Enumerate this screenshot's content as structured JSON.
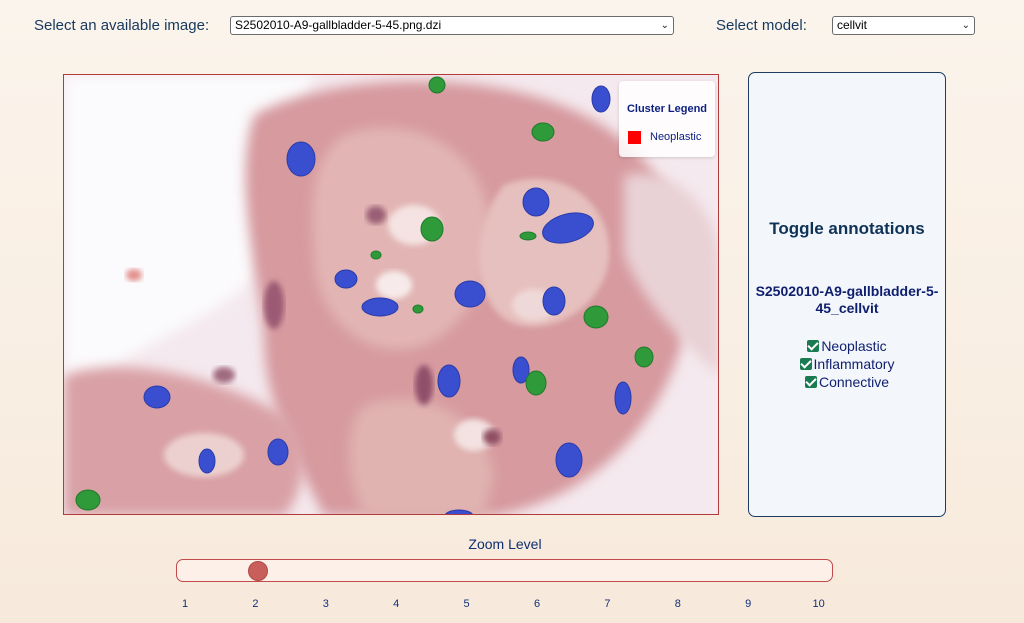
{
  "image_select": {
    "label": "Select an available image:",
    "value": "S2502010-A9-gallbladder-5-45.png.dzi"
  },
  "model_select": {
    "label": "Select model:",
    "value": "cellvit"
  },
  "legend": {
    "title": "Cluster Legend",
    "items": [
      {
        "label": "Neoplastic",
        "color": "#ff0000"
      }
    ]
  },
  "annotations_panel": {
    "title": "Toggle annotations",
    "file": "S2502010-A9-gallbladder-5-45_cellvit",
    "toggles": [
      {
        "label": "Neoplastic",
        "checked": true
      },
      {
        "label": "Inflammatory",
        "checked": true
      },
      {
        "label": "Connective",
        "checked": true
      }
    ]
  },
  "zoom": {
    "title": "Zoom Level",
    "value": 2,
    "min": 1,
    "max": 10,
    "ticks": [
      "1",
      "2",
      "3",
      "4",
      "5",
      "6",
      "7",
      "8",
      "9",
      "10"
    ]
  },
  "colors": {
    "neoplastic_nuclei": "#3a4fd0",
    "other_nuclei": "#2e9a3a",
    "accent": "#c24a4a"
  }
}
